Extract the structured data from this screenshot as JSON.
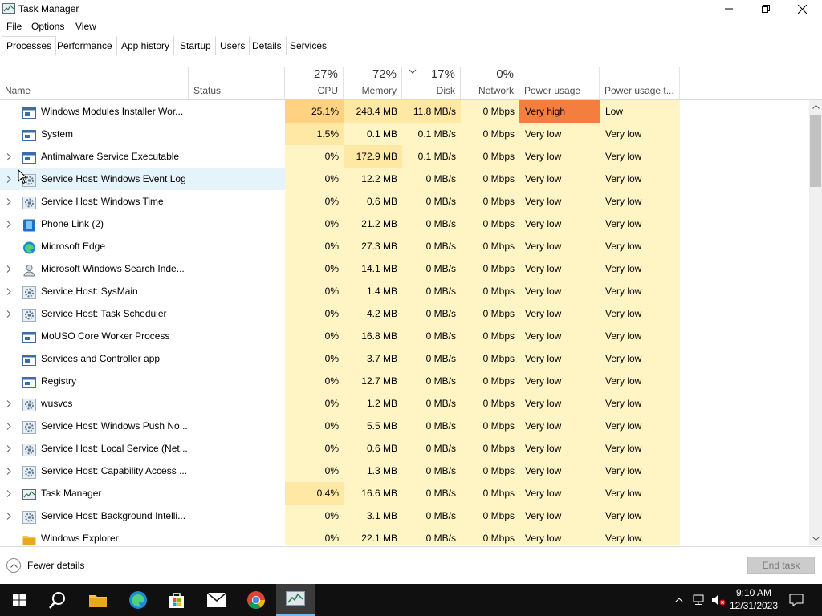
{
  "window": {
    "title": "Task Manager",
    "app_icon": "task-manager-icon"
  },
  "menu": [
    "File",
    "Options",
    "View"
  ],
  "tabs": [
    "Processes",
    "Performance",
    "App history",
    "Startup",
    "Users",
    "Details",
    "Services"
  ],
  "header": {
    "name": "Name",
    "status": "Status",
    "cpu": {
      "pct": "27%",
      "label": "CPU"
    },
    "memory": {
      "pct": "72%",
      "label": "Memory"
    },
    "disk": {
      "pct": "17%",
      "label": "Disk"
    },
    "network": {
      "pct": "0%",
      "label": "Network"
    },
    "power": "Power usage",
    "power_trend": "Power usage t..."
  },
  "colors": {
    "heat_light": "#fff4c4",
    "heat_mid": "#ffe8a3",
    "heat_strong": "#ffd282",
    "very_high": "#f47e3e",
    "hover": "#e5f3fb",
    "taskbar": "#101010",
    "accent": "#76b9ed"
  },
  "processes": [
    {
      "name": "Windows Modules Installer Wor...",
      "icon": "window-icon",
      "expand": false,
      "cpu": "25.1%",
      "memory": "248.4 MB",
      "disk": "11.8 MB/s",
      "network": "0 Mbps",
      "power": "Very high",
      "power_trend": "Low"
    },
    {
      "name": "System",
      "icon": "window-icon",
      "expand": false,
      "cpu": "1.5%",
      "memory": "0.1 MB",
      "disk": "0.1 MB/s",
      "network": "0 Mbps",
      "power": "Very low",
      "power_trend": "Very low"
    },
    {
      "name": "Antimalware Service Executable",
      "icon": "window-icon",
      "expand": true,
      "cpu": "0%",
      "memory": "172.9 MB",
      "disk": "0.1 MB/s",
      "network": "0 Mbps",
      "power": "Very low",
      "power_trend": "Very low"
    },
    {
      "name": "Service Host: Windows Event Log",
      "icon": "gear-icon",
      "expand": true,
      "cpu": "0%",
      "memory": "12.2 MB",
      "disk": "0 MB/s",
      "network": "0 Mbps",
      "power": "Very low",
      "power_trend": "Very low"
    },
    {
      "name": "Service Host: Windows Time",
      "icon": "gear-icon",
      "expand": true,
      "cpu": "0%",
      "memory": "0.6 MB",
      "disk": "0 MB/s",
      "network": "0 Mbps",
      "power": "Very low",
      "power_trend": "Very low"
    },
    {
      "name": "Phone Link (2)",
      "icon": "phone-link-icon",
      "expand": true,
      "cpu": "0%",
      "memory": "21.2 MB",
      "disk": "0 MB/s",
      "network": "0 Mbps",
      "power": "Very low",
      "power_trend": "Very low"
    },
    {
      "name": "Microsoft Edge",
      "icon": "edge-icon",
      "expand": false,
      "cpu": "0%",
      "memory": "27.3 MB",
      "disk": "0 MB/s",
      "network": "0 Mbps",
      "power": "Very low",
      "power_trend": "Very low"
    },
    {
      "name": "Microsoft Windows Search Inde...",
      "icon": "search-indexer-icon",
      "expand": true,
      "cpu": "0%",
      "memory": "14.1 MB",
      "disk": "0 MB/s",
      "network": "0 Mbps",
      "power": "Very low",
      "power_trend": "Very low"
    },
    {
      "name": "Service Host: SysMain",
      "icon": "gear-icon",
      "expand": true,
      "cpu": "0%",
      "memory": "1.4 MB",
      "disk": "0 MB/s",
      "network": "0 Mbps",
      "power": "Very low",
      "power_trend": "Very low"
    },
    {
      "name": "Service Host: Task Scheduler",
      "icon": "gear-icon",
      "expand": true,
      "cpu": "0%",
      "memory": "4.2 MB",
      "disk": "0 MB/s",
      "network": "0 Mbps",
      "power": "Very low",
      "power_trend": "Very low"
    },
    {
      "name": "MoUSO Core Worker Process",
      "icon": "window-icon",
      "expand": false,
      "cpu": "0%",
      "memory": "16.8 MB",
      "disk": "0 MB/s",
      "network": "0 Mbps",
      "power": "Very low",
      "power_trend": "Very low"
    },
    {
      "name": "Services and Controller app",
      "icon": "window-icon",
      "expand": false,
      "cpu": "0%",
      "memory": "3.7 MB",
      "disk": "0 MB/s",
      "network": "0 Mbps",
      "power": "Very low",
      "power_trend": "Very low"
    },
    {
      "name": "Registry",
      "icon": "window-icon",
      "expand": false,
      "cpu": "0%",
      "memory": "12.7 MB",
      "disk": "0 MB/s",
      "network": "0 Mbps",
      "power": "Very low",
      "power_trend": "Very low"
    },
    {
      "name": "wusvcs",
      "icon": "gear-icon",
      "expand": true,
      "cpu": "0%",
      "memory": "1.2 MB",
      "disk": "0 MB/s",
      "network": "0 Mbps",
      "power": "Very low",
      "power_trend": "Very low"
    },
    {
      "name": "Service Host: Windows Push No...",
      "icon": "gear-icon",
      "expand": true,
      "cpu": "0%",
      "memory": "5.5 MB",
      "disk": "0 MB/s",
      "network": "0 Mbps",
      "power": "Very low",
      "power_trend": "Very low"
    },
    {
      "name": "Service Host: Local Service (Net...",
      "icon": "gear-icon",
      "expand": true,
      "cpu": "0%",
      "memory": "0.6 MB",
      "disk": "0 MB/s",
      "network": "0 Mbps",
      "power": "Very low",
      "power_trend": "Very low"
    },
    {
      "name": "Service Host: Capability Access ...",
      "icon": "gear-icon",
      "expand": true,
      "cpu": "0%",
      "memory": "1.3 MB",
      "disk": "0 MB/s",
      "network": "0 Mbps",
      "power": "Very low",
      "power_trend": "Very low"
    },
    {
      "name": "Task Manager",
      "icon": "task-manager-icon",
      "expand": true,
      "cpu": "0.4%",
      "memory": "16.6 MB",
      "disk": "0 MB/s",
      "network": "0 Mbps",
      "power": "Very low",
      "power_trend": "Very low"
    },
    {
      "name": "Service Host: Background Intelli...",
      "icon": "gear-icon",
      "expand": true,
      "cpu": "0%",
      "memory": "3.1 MB",
      "disk": "0 MB/s",
      "network": "0 Mbps",
      "power": "Very low",
      "power_trend": "Very low"
    },
    {
      "name": "Windows Explorer",
      "icon": "folder-icon",
      "expand": false,
      "cpu": "0%",
      "memory": "22.1 MB",
      "disk": "0 MB/s",
      "network": "0 Mbps",
      "power": "Very low",
      "power_trend": "Very low"
    }
  ],
  "footer": {
    "fewer_details": "Fewer details",
    "end_task": "End task"
  },
  "taskbar": {
    "apps": [
      "start-icon",
      "search-icon",
      "file-explorer-icon",
      "edge-icon",
      "store-icon",
      "mail-icon",
      "chrome-icon",
      "task-manager-icon"
    ],
    "clock_time": "9:10 AM",
    "clock_date": "12/31/2023"
  }
}
